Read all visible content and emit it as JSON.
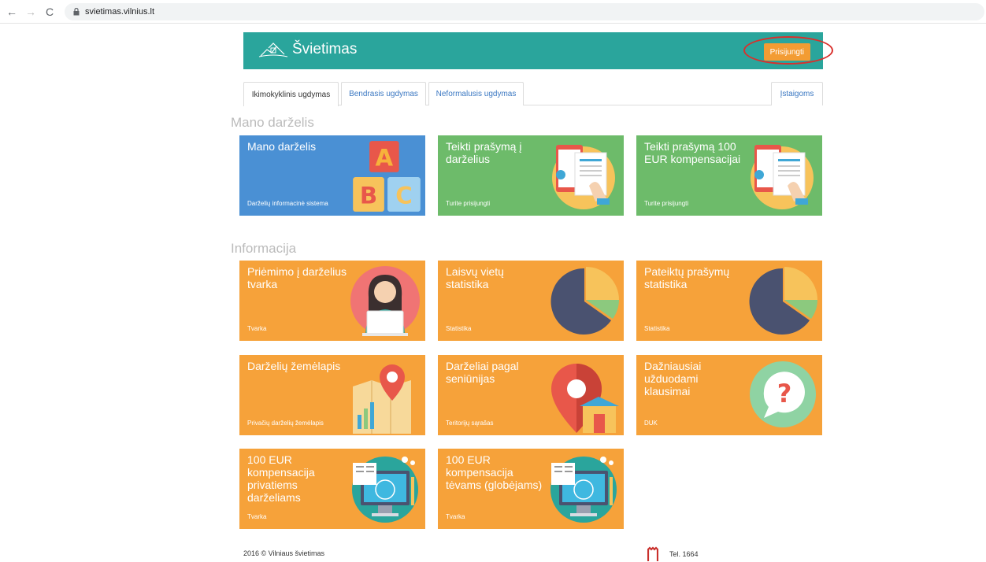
{
  "browser": {
    "url": "svietimas.vilnius.lt"
  },
  "header": {
    "site_title": "Švietimas",
    "login_button": "Prisijungti"
  },
  "tabs": [
    {
      "label": "Ikimokyklinis ugdymas",
      "active": true
    },
    {
      "label": "Bendrasis ugdymas",
      "active": false
    },
    {
      "label": "Neformalusis ugdymas",
      "active": false
    },
    {
      "label": "Įstaigoms",
      "active": false
    }
  ],
  "sections": {
    "mano": "Mano darželis",
    "info": "Informacija"
  },
  "tiles": {
    "mano_darzelis": {
      "title": "Mano darželis",
      "sub": "Darželių informacinė sistema"
    },
    "teikti_darzelius": {
      "title": "Teikti prašymą į darželius",
      "sub": "Turite prisijungti"
    },
    "teikti_kompensacija": {
      "title": "Teikti prašymą 100 EUR kompensacijai",
      "sub": "Turite prisijungti"
    },
    "priemimo": {
      "title": "Priėmimo į darželius tvarka",
      "sub": "Tvarka"
    },
    "laisvu": {
      "title": "Laisvų vietų statistika",
      "sub": "Statistika"
    },
    "pateiktu": {
      "title": "Pateiktų prašymų statistika",
      "sub": "Statistika"
    },
    "zemelapis": {
      "title": "Darželių žemėlapis",
      "sub": "Privačių darželių žemėlapis"
    },
    "seniunijas": {
      "title": "Darželiai pagal seniūnijas",
      "sub": "Teritorijų sąrašas"
    },
    "duk": {
      "title": "Dažniausiai užduodami klausimai",
      "sub": "DUK"
    },
    "komp_privatiems": {
      "title": "100 EUR kompensacija privatiems darželiams",
      "sub": "Tvarka"
    },
    "komp_tevams": {
      "title": "100 EUR kompensacija tėvams (globėjams)",
      "sub": "Tvarka"
    }
  },
  "footer": {
    "copyright": "2016 © Vilniaus švietimas",
    "phone": "Tel. 1664"
  },
  "colors": {
    "header": "#2aa59c",
    "accent": "#f39c33",
    "tile_blue": "#4a90d4",
    "tile_green": "#6dbb6a",
    "tile_orange": "#f6a23a"
  }
}
